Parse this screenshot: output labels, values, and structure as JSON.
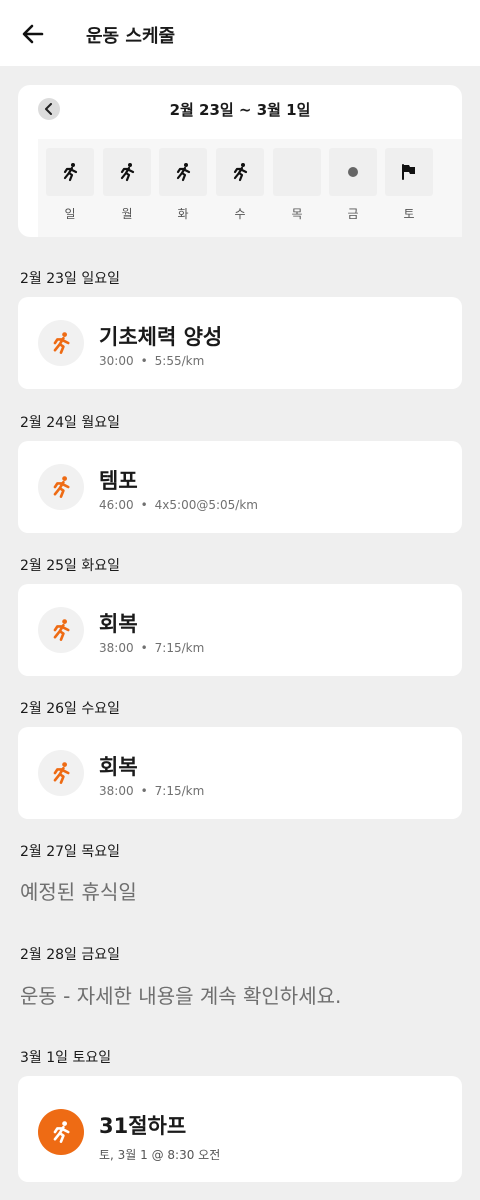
{
  "header": {
    "title": "운동 스케줄"
  },
  "week": {
    "range": "2월 23일 ~ 3월 1일",
    "days": [
      {
        "label": "일",
        "icon": "running-icon"
      },
      {
        "label": "월",
        "icon": "running-icon"
      },
      {
        "label": "화",
        "icon": "running-icon"
      },
      {
        "label": "수",
        "icon": "running-icon"
      },
      {
        "label": "목",
        "icon": "none"
      },
      {
        "label": "금",
        "icon": "dot-icon"
      },
      {
        "label": "토",
        "icon": "flag-icon"
      }
    ]
  },
  "schedule": [
    {
      "date": "2월 23일 일요일",
      "title": "기초체력 양성",
      "duration": "30:00",
      "detail": "5:55/km"
    },
    {
      "date": "2월 24일 월요일",
      "title": "템포",
      "duration": "46:00",
      "detail": "4x5:00@5:05/km"
    },
    {
      "date": "2월 25일 화요일",
      "title": "회복",
      "duration": "38:00",
      "detail": "7:15/km"
    },
    {
      "date": "2월 26일 수요일",
      "title": "회복",
      "duration": "38:00",
      "detail": "7:15/km"
    },
    {
      "date": "2월 27일 목요일",
      "note": "예정된 휴식일"
    },
    {
      "date": "2월 28일 금요일",
      "note": "운동 - 자세한 내용을 계속 확인하세요."
    },
    {
      "date": "3월 1일 토요일",
      "title": "31절하프",
      "when": "토, 3월 1 @ 8:30 오전"
    }
  ],
  "separator": "•",
  "colors": {
    "accent": "#ee6b14",
    "background": "#efefef",
    "card": "#ffffff"
  }
}
